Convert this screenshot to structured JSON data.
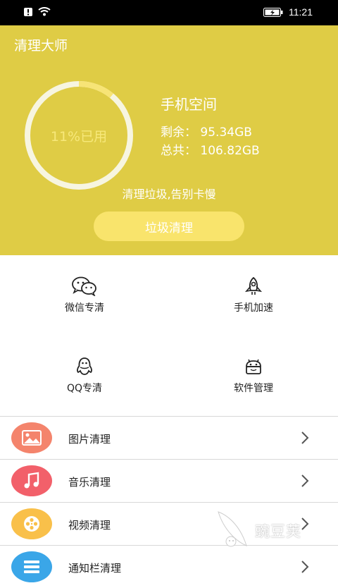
{
  "status_bar": {
    "time": "11:21"
  },
  "app": {
    "title": "清理大师"
  },
  "storage": {
    "used_label": "11%已用",
    "used_fraction": 0.11,
    "title": "手机空间",
    "remaining": "剩余：  95.34GB",
    "total": "总共：  106.82GB"
  },
  "slogan": "清理垃圾,告别卡慢",
  "clean_button": "垃圾清理",
  "tools": [
    {
      "label": "微信专清",
      "icon": "wechat-icon"
    },
    {
      "label": "手机加速",
      "icon": "rocket-icon"
    },
    {
      "label": "QQ专清",
      "icon": "qq-penguin-icon"
    },
    {
      "label": "软件管理",
      "icon": "android-icon"
    }
  ],
  "list": [
    {
      "label": "图片清理",
      "icon": "picture-icon",
      "color": "#f4846c"
    },
    {
      "label": "音乐清理",
      "icon": "music-note-icon",
      "color": "#f2606a"
    },
    {
      "label": "视频清理",
      "icon": "film-reel-icon",
      "color": "#f9c04a"
    },
    {
      "label": "通知栏清理",
      "icon": "notification-icon",
      "color": "#3aa6e8"
    }
  ],
  "watermark": "豌豆荚",
  "colors": {
    "accent": "#dfcc45",
    "button": "#f9e46c"
  }
}
